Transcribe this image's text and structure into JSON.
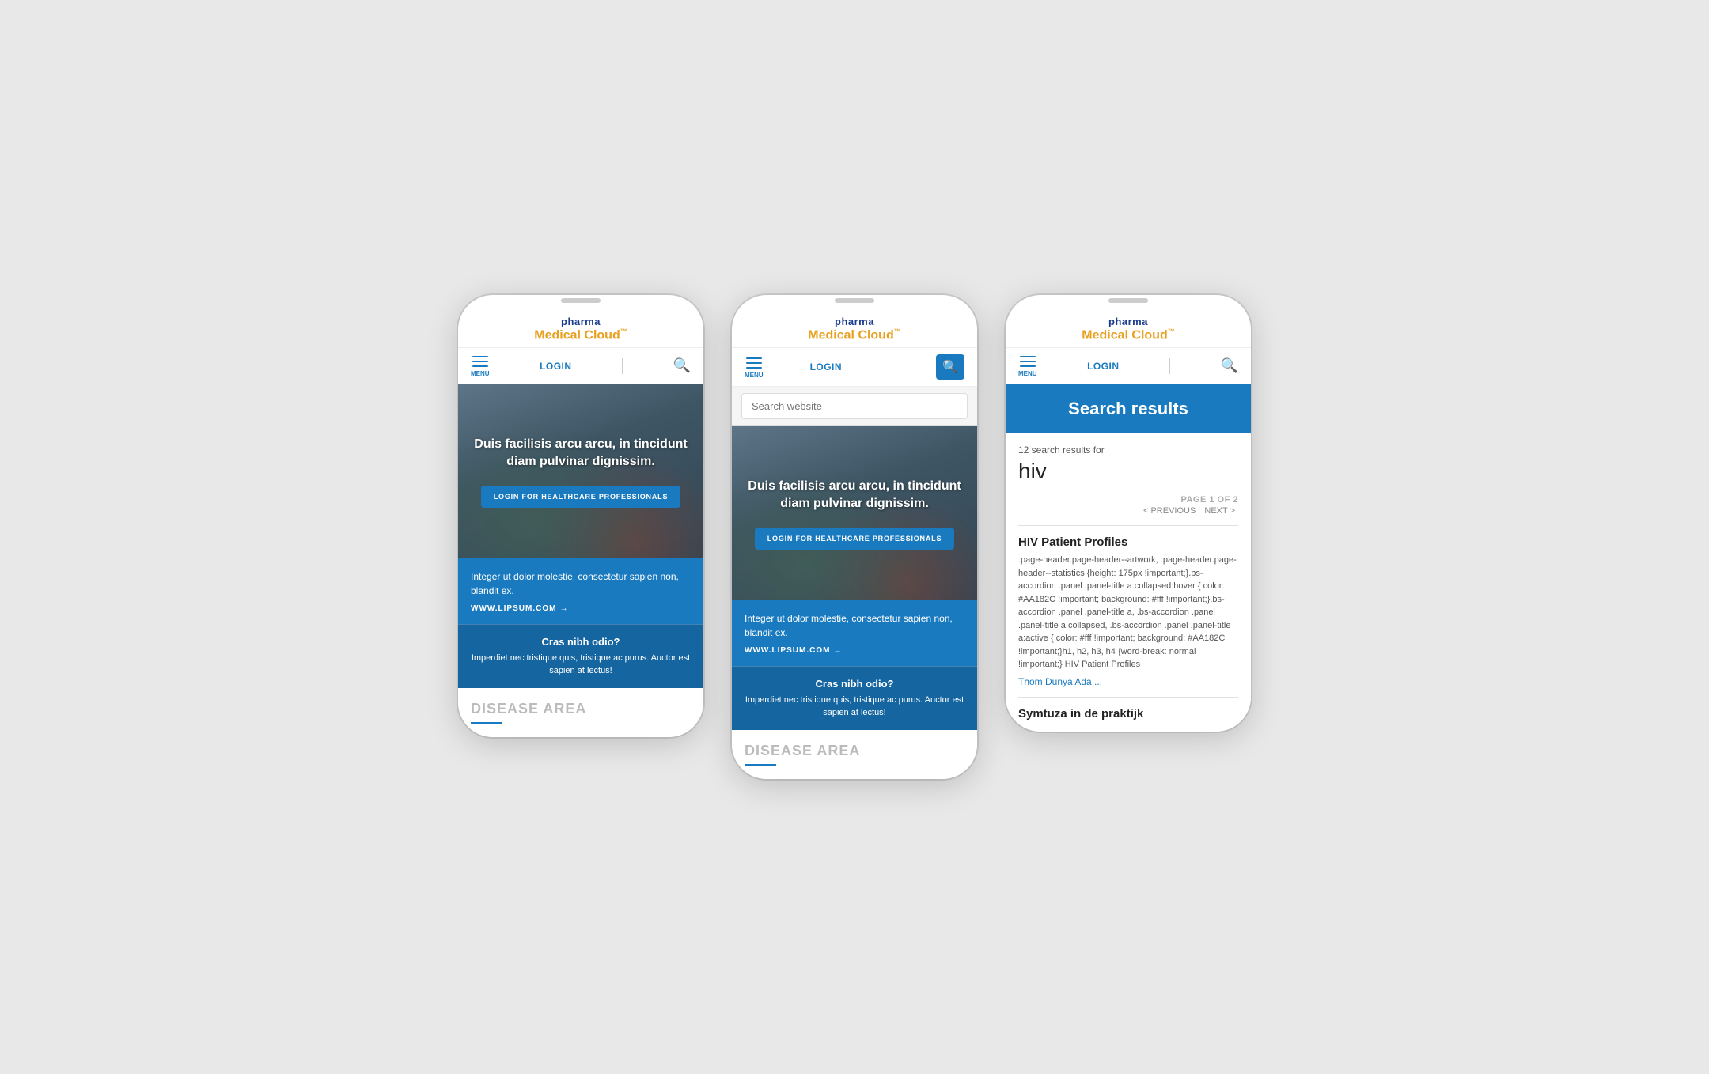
{
  "brand": {
    "pharma": "pharma",
    "medical": "Medical Cloud",
    "tm": "™"
  },
  "nav": {
    "menu_label": "MENU",
    "login_label": "LOGIN"
  },
  "hero": {
    "headline": "Duis facilisis arcu arcu, in tincidunt diam pulvinar dignissim.",
    "cta_button": "LOGIN FOR HEALTHCARE PROFESSIONALS"
  },
  "content": {
    "body_text": "Integer ut dolor molestie, consectetur sapien non, blandit ex.",
    "link_text": "WWW.LIPSUM.COM",
    "cta_title": "Cras nibh odio?",
    "cta_body": "Imperdiet nec tristique quis, tristique ac purus. Auctor est sapien at lectus!"
  },
  "disease": {
    "label": "DISEASE AREA"
  },
  "search": {
    "placeholder": "Search website"
  },
  "search_results": {
    "heading": "Search results",
    "count_label": "12 search results for",
    "query": "hiv",
    "pagination_label": "PAGE 1 OF 2",
    "prev": "< PREVIOUS",
    "next": "NEXT >",
    "results": [
      {
        "title": "HIV Patient Profiles",
        "snippet": ".page-header.page-header--artwork, .page-header.page-header--statistics {height: 175px !important;}.bs-accordion .panel .panel-title a.collapsed:hover { color: #AA182C !important; background: #fff !important;}.bs-accordion .panel .panel-title a, .bs-accordion .panel .panel-title a.collapsed, .bs-accordion .panel .panel-title a:active { color: #fff !important; background: #AA182C !important;}h1, h2, h3, h4 {word-break: normal !important;} HIV Patient Profiles",
        "link": "Thom Dunya Ada ..."
      },
      {
        "title": "Symtuza in de praktijk",
        "snippet": "",
        "link": ""
      }
    ]
  }
}
